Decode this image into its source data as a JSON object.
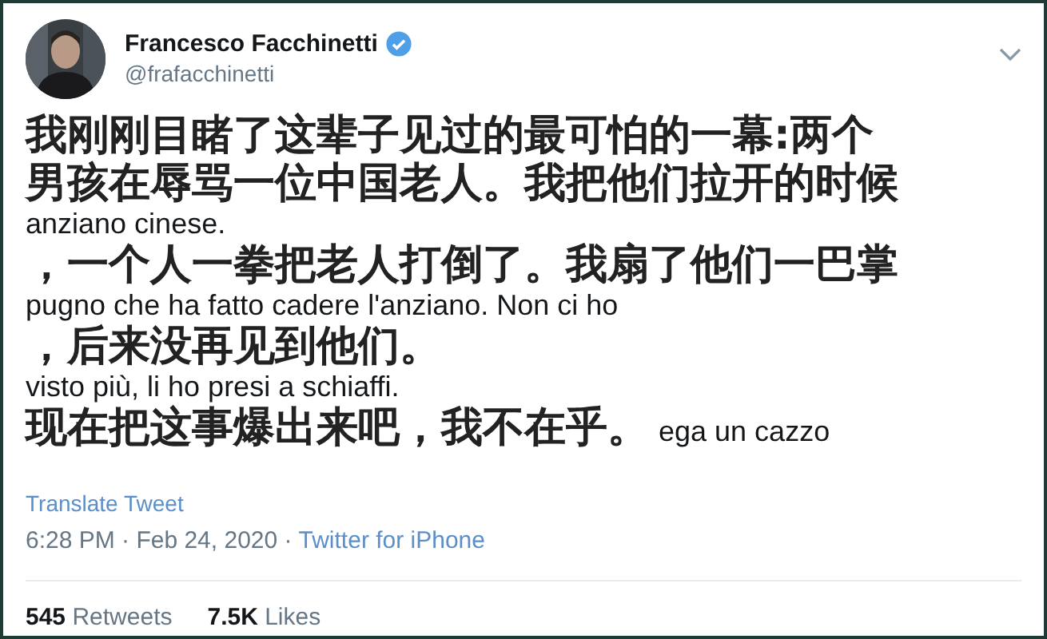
{
  "author": {
    "name": "Francesco Facchinetti",
    "handle": "@frafacchinetti",
    "verified": true
  },
  "lines": [
    {
      "kind": "overlay",
      "text": "我刚刚目睹了这辈子见过的最可怕的一幕:两个"
    },
    {
      "kind": "overlay",
      "text": "男孩在辱骂一位中国老人。我把他们拉开的时候"
    },
    {
      "kind": "original",
      "text": "anziano cinese."
    },
    {
      "kind": "overlay",
      "text": "，一个人一拳把老人打倒了。我扇了他们一巴掌"
    },
    {
      "kind": "original",
      "text": "pugno che ha fatto cadere l'anziano. Non ci ho"
    },
    {
      "kind": "overlay",
      "text": "，后来没再见到他们。"
    },
    {
      "kind": "original",
      "text": "visto più, li ho presi a schiaffi."
    },
    {
      "kind": "overlay",
      "text": "现在把这事爆出来吧，我不在乎。",
      "tail": "ega un cazzo"
    }
  ],
  "translate_link": "Translate Tweet",
  "meta": {
    "time": "6:28 PM · Feb 24, 2020 ·",
    "source": "Twitter for iPhone"
  },
  "stats": [
    {
      "count": "545",
      "label": "Retweets"
    },
    {
      "count": "7.5K",
      "label": "Likes"
    }
  ]
}
